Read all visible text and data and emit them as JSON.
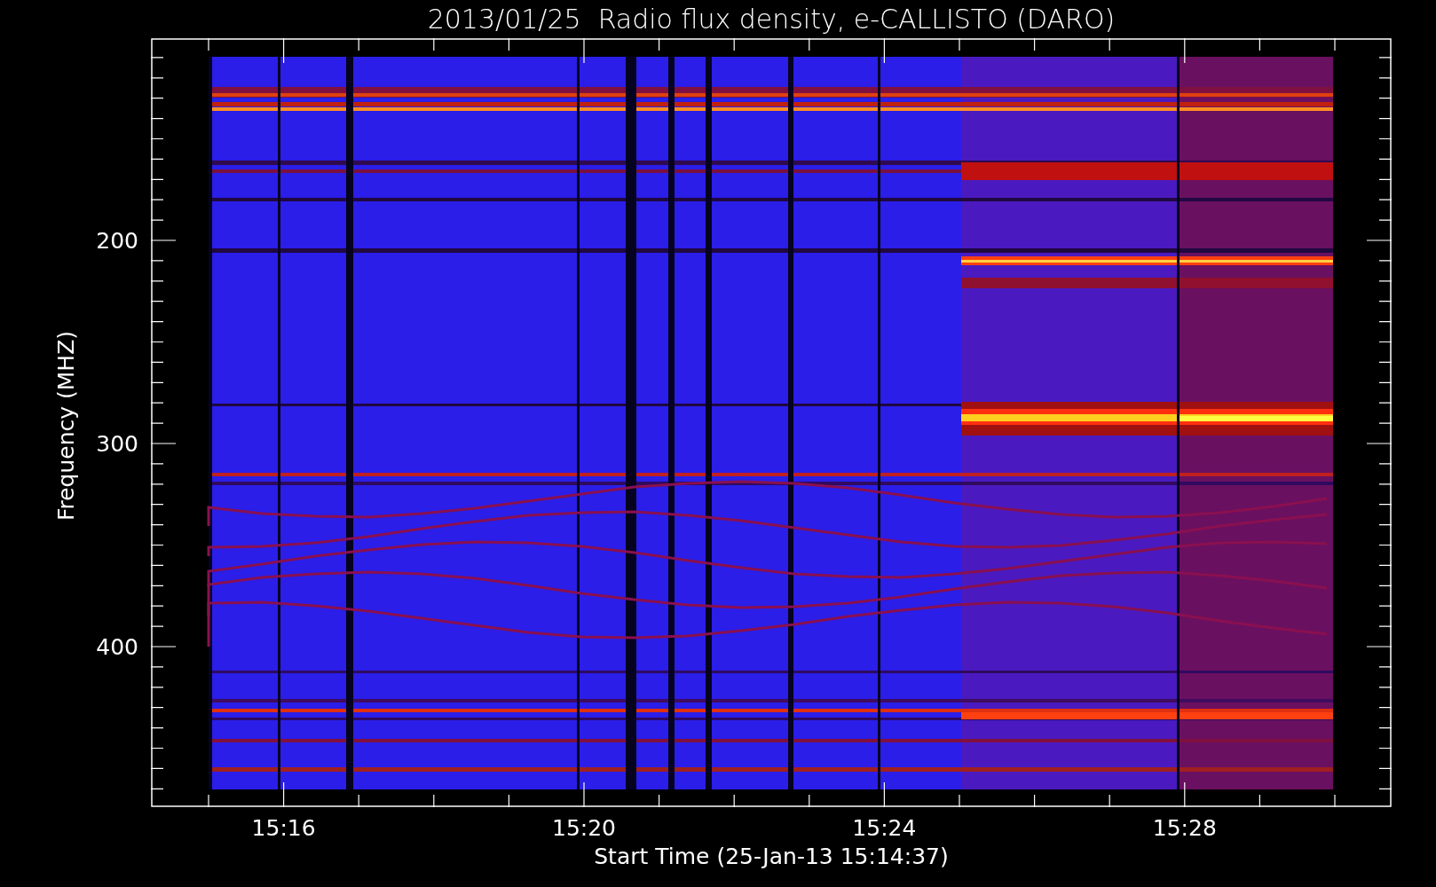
{
  "title": "2013/01/25  Radio flux density, e-CALLISTO (DARO)",
  "y_axis": {
    "label": "Frequency (MHZ)",
    "ticks": [
      "200",
      "300",
      "400"
    ]
  },
  "x_axis": {
    "label": "Start Time (25-Jan-13 15:14:37)",
    "ticks": [
      "15:16",
      "15:20",
      "15:24",
      "15:28"
    ]
  }
}
